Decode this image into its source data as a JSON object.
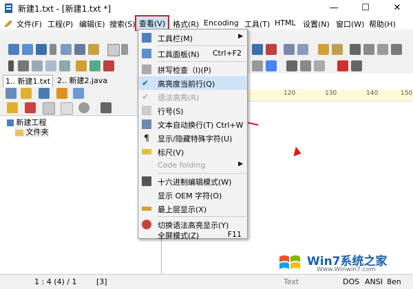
{
  "window": {
    "title": "新建1.txt - [新建1.txt *]",
    "minimize": "—",
    "maximize": "☐",
    "close": "✕"
  },
  "menubar": [
    {
      "label": "文件(F)"
    },
    {
      "label": "工程(P)"
    },
    {
      "label": "编辑(E)"
    },
    {
      "label": "搜索(S)"
    },
    {
      "label": "查看(V)"
    },
    {
      "label": "格式(R)"
    },
    {
      "label": "Encoding"
    },
    {
      "label": "工具(T)"
    },
    {
      "label": "HTML"
    },
    {
      "label": "设置(N)"
    },
    {
      "label": "窗口(W)"
    },
    {
      "label": "帮助(H)"
    }
  ],
  "doc_tabs": [
    {
      "label": "1.. 新建1.txt"
    },
    {
      "label": "2.. 新建2.java"
    }
  ],
  "tree": {
    "project": "新建工程",
    "folder": "文件夹"
  },
  "ruler": {
    "marks": [
      "120",
      "130",
      "140",
      "150"
    ]
  },
  "view_menu": {
    "items": [
      {
        "label": "工具栏(M)",
        "shortcut": "",
        "submenu": true
      },
      {
        "label": "工具面板(N)",
        "shortcut": "Ctrl+F2"
      },
      {
        "label": "拼写检查（I)(P)",
        "shortcut": ""
      },
      {
        "label": "高亮度当前行(Q)",
        "shortcut": ""
      },
      {
        "label": "语法高亮(R)",
        "shortcut": ""
      },
      {
        "label": "行号(S)",
        "shortcut": ""
      },
      {
        "label": "文本自动换行(T) Ctrl+W",
        "shortcut": ""
      },
      {
        "label": "显示/隐藏特殊字符(U)",
        "shortcut": ""
      },
      {
        "label": "标尺(V)",
        "shortcut": ""
      },
      {
        "label": "Code folding",
        "shortcut": "",
        "submenu": true
      },
      {
        "label": "十六进制编辑模式(W)",
        "shortcut": ""
      },
      {
        "label": "显示 OEM 字符(O)",
        "shortcut": ""
      },
      {
        "label": "最上层显示(X)",
        "shortcut": ""
      },
      {
        "label": "切换语法高亮显示(Y)",
        "shortcut": ""
      },
      {
        "label": "全屏模式(Z)",
        "shortcut": "F11"
      }
    ]
  },
  "status": {
    "position": "1 : 4 (4) / 1",
    "col": "[3]",
    "mode": "Text",
    "lineend": "DOS",
    "encoding": "ANSI",
    "extra": "8en"
  },
  "watermark": {
    "brand": "Win7系统之家",
    "url": "Www.Winwin7.com"
  },
  "colors": {
    "accent_red": "#e01818",
    "menu_highlight": "#cce4f7",
    "ruler_bg": "#fff9d8"
  }
}
